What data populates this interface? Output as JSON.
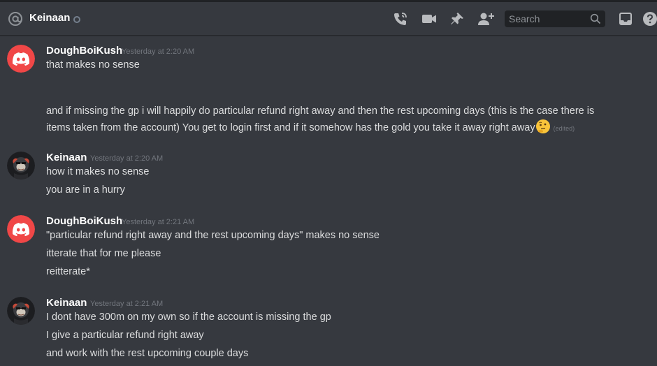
{
  "header": {
    "channel_name": "Keinaan",
    "search_placeholder": "Search"
  },
  "colors": {
    "background": "#36393f",
    "header_text": "#ffffff",
    "text": "#dcddde",
    "timestamp": "#72767d",
    "discord_red": "#f04747",
    "search_bg": "#202225"
  },
  "icons": [
    "at-icon",
    "status-dot",
    "voice-call-icon",
    "video-call-icon",
    "pin-icon",
    "add-member-icon",
    "search-icon",
    "inbox-icon",
    "help-icon",
    "thinking-emoji"
  ],
  "messages": [
    {
      "author": "DoughBoiKush",
      "avatar": "discord-logo-avatar",
      "timestamp": "Yesterday at 2:20 AM",
      "lines": [
        "that makes no sense",
        "",
        "and if missing the gp i will happily do particular refund right away and then the rest upcoming days (this is the case there is",
        "items taken from the account) You get to login first and if it somehow has the gold you take it away right away"
      ],
      "edited_label": "(edited)"
    },
    {
      "author": "Keinaan",
      "avatar": "monkey-avatar",
      "timestamp": "Yesterday at 2:20 AM",
      "lines": [
        "how it makes no sense",
        "you are in a hurry"
      ]
    },
    {
      "author": "DoughBoiKush",
      "avatar": "discord-logo-avatar",
      "timestamp": "Yesterday at 2:21 AM",
      "lines": [
        "\"particular refund right away and the rest upcoming days\" makes no sense",
        "itterate that for me please",
        "reitterate*"
      ]
    },
    {
      "author": "Keinaan",
      "avatar": "monkey-avatar",
      "timestamp": "Yesterday at 2:21 AM",
      "lines": [
        "I dont have 300m on my own so if the account is missing the gp",
        "I give a particular refund right away",
        "and work with the rest upcoming couple days"
      ]
    }
  ]
}
